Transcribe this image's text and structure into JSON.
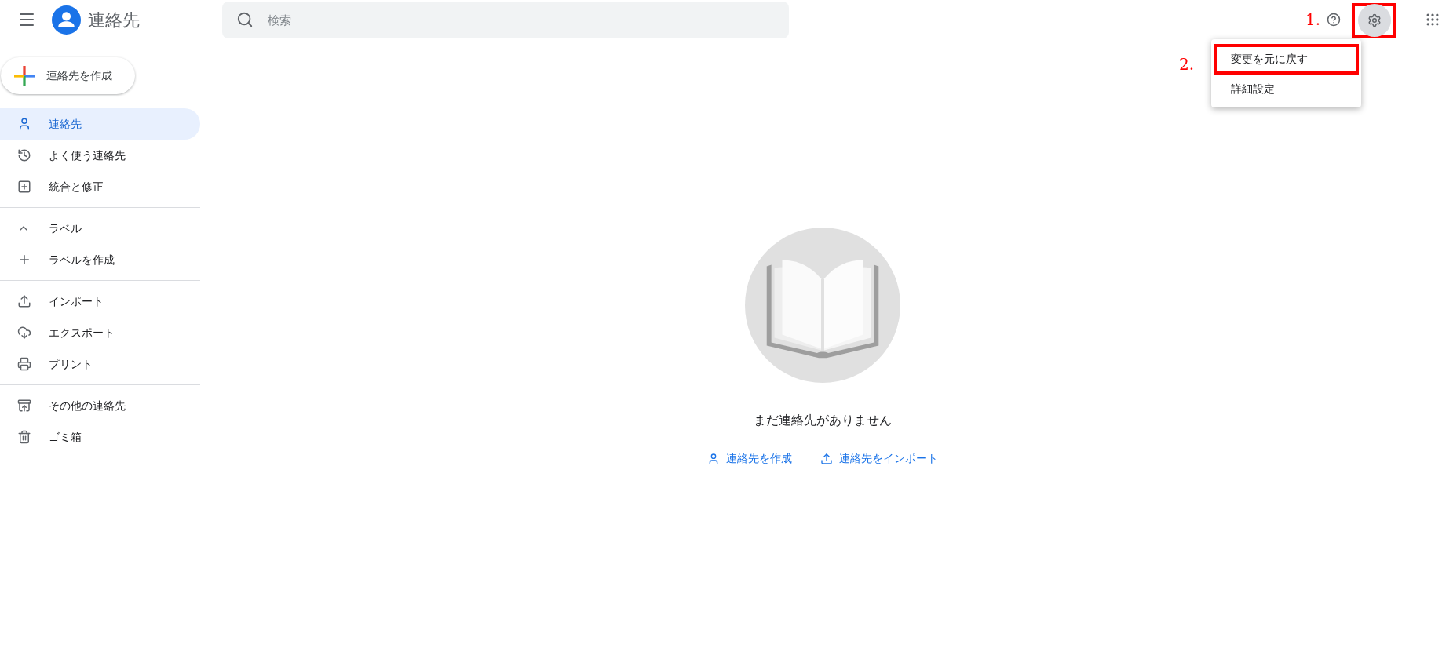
{
  "header": {
    "title": "連絡先",
    "search": {
      "placeholder": "検索"
    }
  },
  "settings_menu": {
    "open": true,
    "items": [
      {
        "label": "変更を元に戻す"
      },
      {
        "label": "詳細設定"
      }
    ]
  },
  "annotations": [
    {
      "label": "1."
    },
    {
      "label": "2."
    }
  ],
  "sidebar": {
    "create_button": "連絡先を作成",
    "sections": [
      {
        "items": [
          {
            "kind": "link",
            "label": "連絡先",
            "selected": true
          },
          {
            "kind": "link",
            "label": "よく使う連絡先",
            "selected": false
          },
          {
            "kind": "link",
            "label": "統合と修正",
            "selected": false
          }
        ]
      },
      {
        "items": [
          {
            "kind": "toggle",
            "label": "ラベル",
            "expanded": true
          },
          {
            "kind": "link",
            "label": "ラベルを作成",
            "selected": false
          }
        ]
      },
      {
        "items": [
          {
            "kind": "link",
            "label": "インポート",
            "selected": false
          },
          {
            "kind": "link",
            "label": "エクスポート",
            "selected": false
          },
          {
            "kind": "link",
            "label": "プリント",
            "selected": false
          }
        ]
      },
      {
        "items": [
          {
            "kind": "link",
            "label": "その他の連絡先",
            "selected": false
          },
          {
            "kind": "link",
            "label": "ゴミ箱",
            "selected": false
          }
        ]
      }
    ]
  },
  "empty_state": {
    "message": "まだ連絡先がありません",
    "actions": [
      {
        "label": "連絡先を作成"
      },
      {
        "label": "連絡先をインポート"
      }
    ]
  }
}
